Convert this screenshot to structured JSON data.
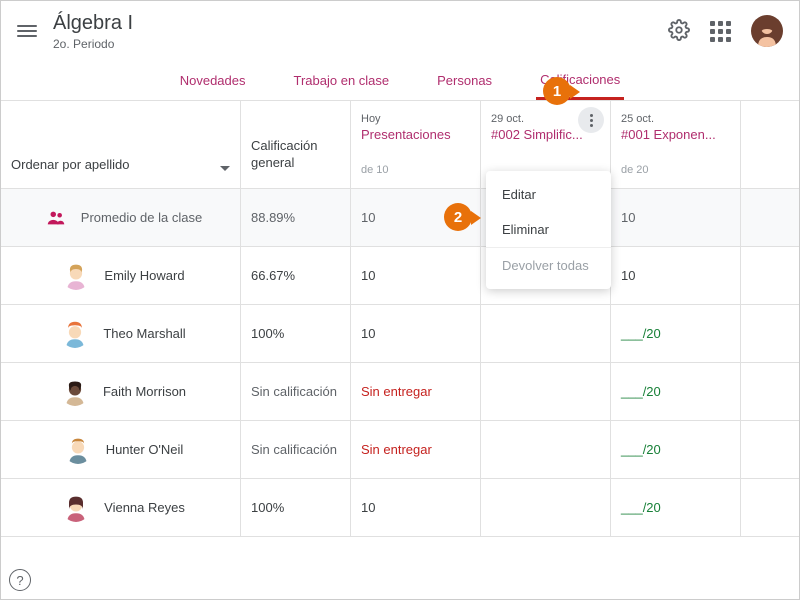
{
  "header": {
    "class_title": "Álgebra I",
    "class_subtitle": "2o. Periodo"
  },
  "tabs": {
    "novedades": "Novedades",
    "trabajo": "Trabajo en clase",
    "personas": "Personas",
    "calificaciones": "Calificaciones"
  },
  "columns": {
    "sort_label": "Ordenar por apellido",
    "overall_line1": "Calificación",
    "overall_line2": "general",
    "col1": {
      "date": "Hoy",
      "title": "Presentaciones",
      "of": "de 10"
    },
    "col2": {
      "date": "29 oct.",
      "title": "#002 Simplific...",
      "of": ""
    },
    "col3": {
      "date": "25 oct.",
      "title": "#001 Exponen...",
      "of": "de 20"
    }
  },
  "menu": {
    "editar": "Editar",
    "eliminar": "Eliminar",
    "devolver": "Devolver todas"
  },
  "rows": {
    "avg": {
      "name": "Promedio de la clase",
      "overall": "88.89%",
      "c1": "10",
      "c2": "",
      "c3": "10"
    },
    "r1": {
      "name": "Emily Howard",
      "overall": "66.67%",
      "c1": "10",
      "c2": "",
      "c3": "10"
    },
    "r2": {
      "name": "Theo Marshall",
      "overall": "100%",
      "c1": "10",
      "c2": "",
      "c3": "___/20"
    },
    "r3": {
      "name": "Faith Morrison",
      "overall": "Sin calificación",
      "c1": "Sin entregar",
      "c2": "",
      "c3": "___/20"
    },
    "r4": {
      "name": "Hunter O'Neil",
      "overall": "Sin calificación",
      "c1": "Sin entregar",
      "c2": "",
      "c3": "___/20"
    },
    "r5": {
      "name": "Vienna Reyes",
      "overall": "100%",
      "c1": "10",
      "c2": "",
      "c3": "___/20"
    }
  },
  "callouts": {
    "one": "1",
    "two": "2"
  }
}
